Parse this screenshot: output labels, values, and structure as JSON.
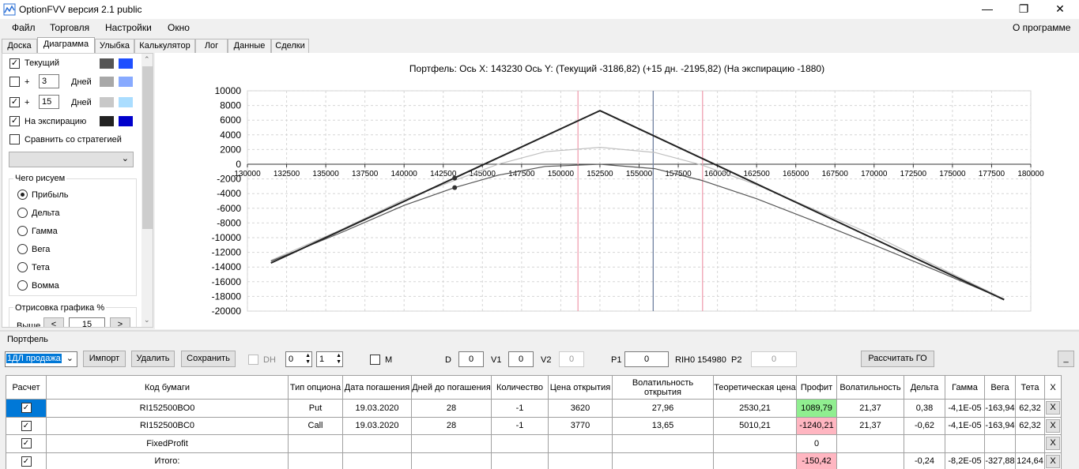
{
  "window": {
    "title": "OptionFVV версия 2.1 public",
    "minimize": "—",
    "maximize": "❐",
    "close": "✕"
  },
  "menu": {
    "items": [
      "Файл",
      "Торговля",
      "Настройки",
      "Окно"
    ],
    "about": "О программе"
  },
  "tabs": [
    "Доска",
    "Диаграмма",
    "Улыбка",
    "Калькулятор",
    "Лог",
    "Данные",
    "Сделки"
  ],
  "left": {
    "current": {
      "label": "Текущий",
      "checked": true
    },
    "plus1": {
      "prefix": "+",
      "value": "3",
      "suffix": "Дней",
      "checked": false
    },
    "plus2": {
      "prefix": "+",
      "value": "15",
      "suffix": "Дней",
      "checked": true
    },
    "expiry": {
      "label": "На экспирацию",
      "checked": true
    },
    "compare": {
      "label": "Сравнить со стратегией",
      "checked": false
    },
    "what_group": "Чего рисуем",
    "radios": [
      "Прибыль",
      "Дельта",
      "Гамма",
      "Вега",
      "Тета",
      "Вомма"
    ],
    "draw_group": "Отрисовка графика %",
    "above_label": "Выше",
    "above_value": "15",
    "prev": "<",
    "next": ">",
    "colors": [
      "#555555",
      "#1f4fff",
      "#a8a8a8",
      "#88aaff",
      "#c8c8c8",
      "#aaddff",
      "#222222",
      "#0000cc"
    ]
  },
  "chart_data": {
    "type": "line",
    "title": "Портфель:  Ось X:  143230  Ось Y:   (Текущий -3186,82)   (+15 дн. -2195,82)   (На экспирацию -1880)",
    "xlim": [
      130000,
      180000
    ],
    "ylim": [
      -20000,
      10000
    ],
    "xticks": [
      130000,
      132500,
      135000,
      137500,
      140000,
      142500,
      145000,
      147500,
      150000,
      152500,
      155000,
      157500,
      160000,
      162500,
      165000,
      167500,
      170000,
      172500,
      175000,
      177500,
      180000
    ],
    "yticks": [
      10000,
      8000,
      6000,
      4000,
      2000,
      0,
      -2000,
      -4000,
      -6000,
      -8000,
      -10000,
      -12000,
      -14000,
      -16000,
      -18000,
      -20000
    ],
    "vlines": [
      {
        "x": 151100,
        "color": "#f0a0b0"
      },
      {
        "x": 155900,
        "color": "#7080a0"
      },
      {
        "x": 159050,
        "color": "#f0a0b0"
      }
    ],
    "series": [
      {
        "name": "На экспирацию",
        "color": "#222222",
        "x": [
          131500,
          152500,
          178300
        ],
        "y": [
          -13450,
          7300,
          -18450
        ]
      },
      {
        "name": "+15 дн.",
        "color": "#c0c0c0",
        "x": [
          131500,
          136000,
          140000,
          143230,
          146000,
          149000,
          152500,
          156000,
          159000,
          162500,
          166000,
          170000,
          174000,
          178300
        ],
        "y": [
          -13100,
          -8900,
          -4800,
          -2196,
          0,
          1700,
          2300,
          1600,
          -100,
          -2800,
          -6000,
          -9700,
          -13900,
          -18350
        ]
      },
      {
        "name": "Текущий",
        "color": "#555555",
        "x": [
          131500,
          136000,
          140000,
          143230,
          146000,
          149000,
          152500,
          156000,
          159000,
          162500,
          166000,
          170000,
          174000,
          178300
        ],
        "y": [
          -13200,
          -9300,
          -5600,
          -3187,
          -1500,
          -300,
          0,
          -600,
          -2200,
          -4700,
          -7600,
          -11000,
          -14500,
          -18400
        ]
      }
    ],
    "markers": [
      {
        "x": 143230,
        "y": -1880
      },
      {
        "x": 143230,
        "y": -3187
      }
    ]
  },
  "bottom": {
    "panel_label": "Портфель",
    "portfolio_select": "1ДЛ продажа",
    "import": "Импорт",
    "delete": "Удалить",
    "save": "Сохранить",
    "dh_label": "DH",
    "spin1": "0",
    "spin2": "1",
    "m_label": "M",
    "d_label": "D",
    "d_value": "0",
    "v1_label": "V1",
    "v1_value": "0",
    "v2_label": "V2",
    "v2_value": "0",
    "p1_label": "P1",
    "p1_value": "0",
    "ticker": "RIH0 154980",
    "p2_label": "P2",
    "p2_value": "0",
    "calc_go": "Рассчитать ГО",
    "collapse": "_"
  },
  "table": {
    "headers": [
      "Расчет",
      "Код бумаги",
      "Тип опциона",
      "Дата погашения",
      "Дней до погашения",
      "Количество",
      "Цена открытия",
      "Волатильность открытия",
      "Теоретическая цена",
      "Профит",
      "Волатильность",
      "Дельта",
      "Гамма",
      "Вега",
      "Тета",
      "X"
    ],
    "rows": [
      [
        "✓",
        "RI152500BO0",
        "Put",
        "19.03.2020",
        "28",
        "-1",
        "3620",
        "27,96",
        "2530,21",
        "1089,79",
        "21,37",
        "0,38",
        "-4,1E-05",
        "-163,94",
        "62,32",
        "X"
      ],
      [
        "✓",
        "RI152500BC0",
        "Call",
        "19.03.2020",
        "28",
        "-1",
        "3770",
        "13,65",
        "5010,21",
        "-1240,21",
        "21,37",
        "-0,62",
        "-4,1E-05",
        "-163,94",
        "62,32",
        "X"
      ],
      [
        "✓",
        "FixedProfit",
        "",
        "",
        "",
        "",
        "",
        "",
        "",
        "0",
        "",
        "",
        "",
        "",
        "",
        "X"
      ],
      [
        "✓",
        "Итого:",
        "",
        "",
        "",
        "",
        "",
        "",
        "",
        "-150,42",
        "",
        "-0,24",
        "-8,2E-05",
        "-327,88",
        "124,64",
        "X"
      ]
    ],
    "profit_colors": [
      "#90ee90",
      "#ffb6c1",
      "#ffffff",
      "#ffb6c1"
    ],
    "selected_color": "#0078d7"
  }
}
